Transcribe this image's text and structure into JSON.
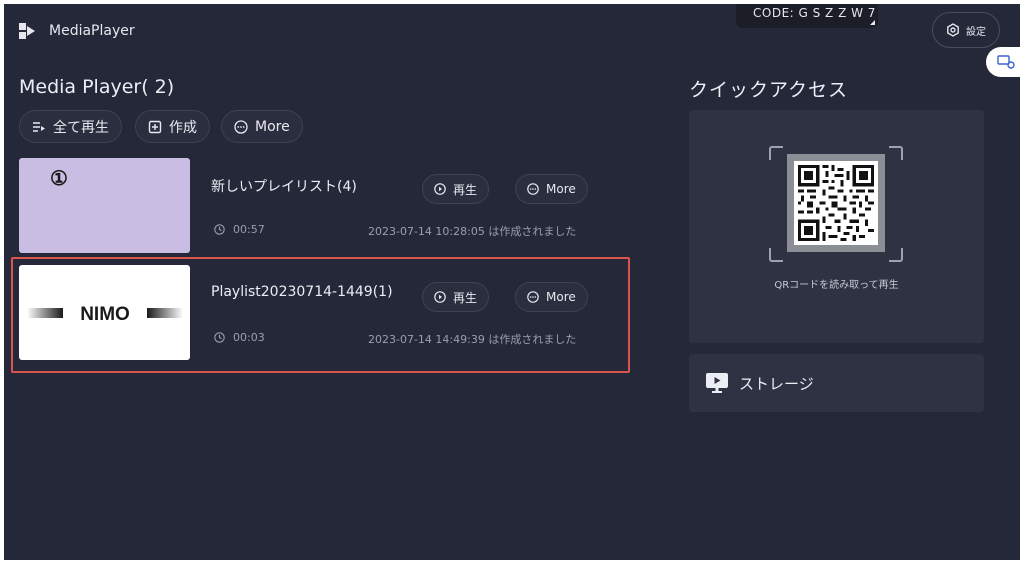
{
  "app": {
    "name": "MediaPlayer"
  },
  "code": {
    "text": "CODE: G S Z Z W 7"
  },
  "settings": {
    "label": "設定"
  },
  "main": {
    "title": "Media Player( 2)",
    "actions": [
      {
        "label": "全て再生",
        "icon": "play-all-icon"
      },
      {
        "label": "作成",
        "icon": "create-icon"
      },
      {
        "label": "More",
        "icon": "more-icon"
      }
    ]
  },
  "playlists": [
    {
      "badge": "①",
      "name": "新しいプレイリスト(4)",
      "play_label": "再生",
      "more_label": "More",
      "duration": "00:57",
      "created": "2023-07-14 10:28:05 は作成されました",
      "thumb_color": "#c9bde3"
    },
    {
      "logo_text": "NIMO",
      "name": "Playlist20230714-1449(1)",
      "play_label": "再生",
      "more_label": "More",
      "duration": "00:03",
      "created": "2023-07-14 14:49:39 は作成されました",
      "thumb_color": "#ffffff",
      "highlighted": true
    }
  ],
  "quick_access": {
    "title": "クイックアクセス",
    "qr_caption": "QRコードを読み取って再生",
    "storage_label": "ストレージ"
  },
  "colors": {
    "background": "#252838",
    "panel": "#2f3243",
    "highlight": "#d9534f"
  }
}
